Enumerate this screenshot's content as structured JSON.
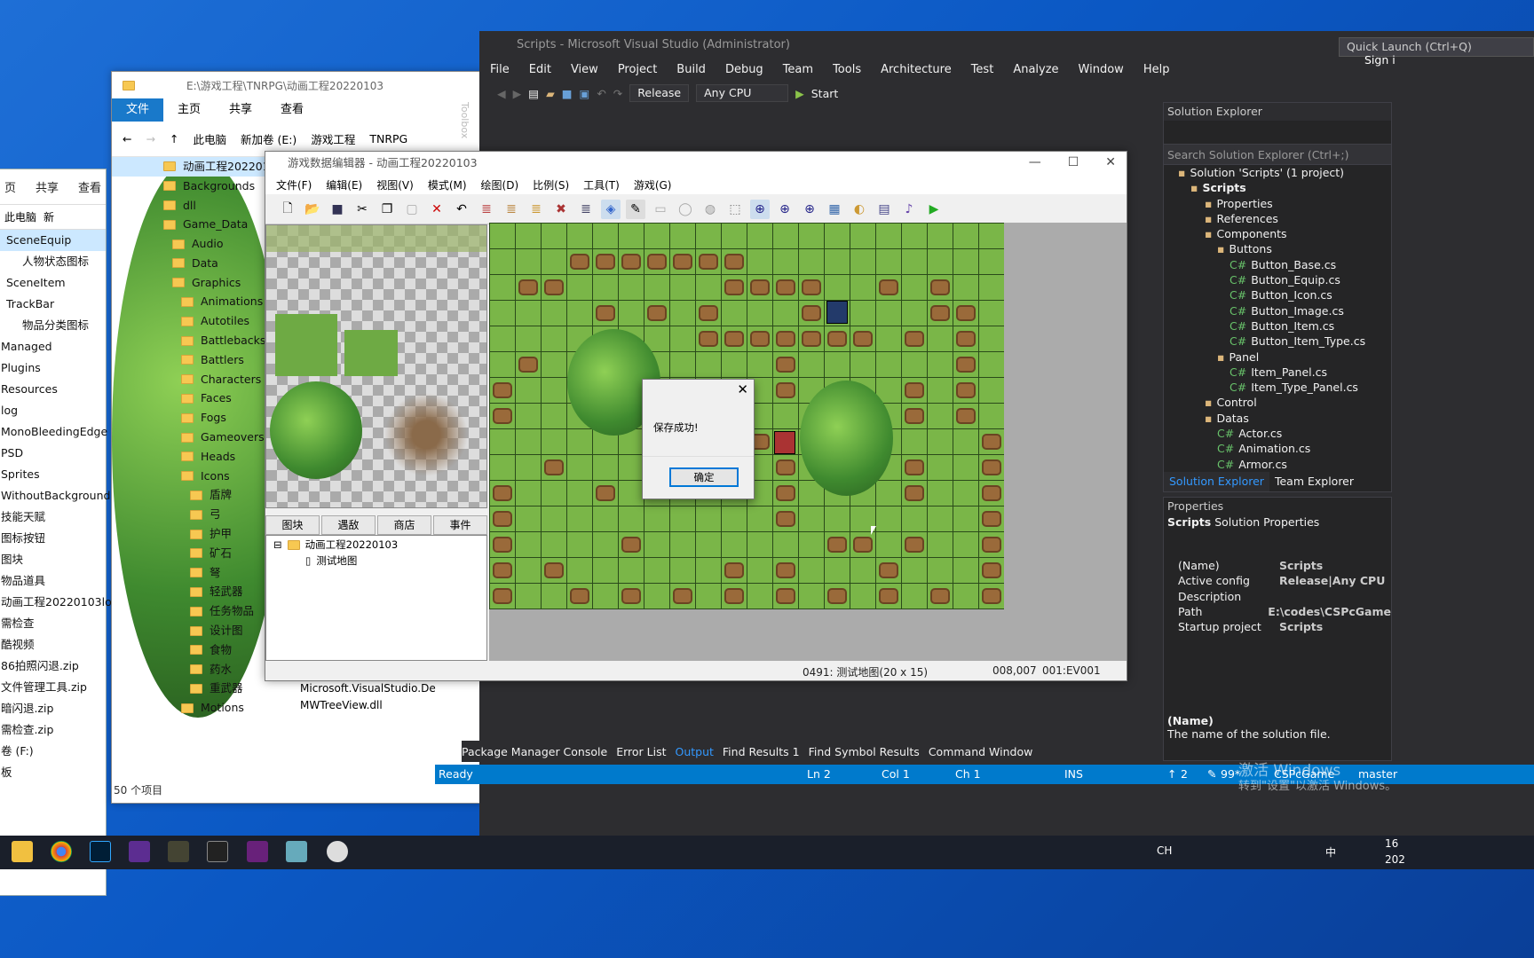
{
  "explorer_back": {
    "ribbon": [
      "页",
      "共享",
      "查看"
    ],
    "address": [
      "此电脑",
      "新"
    ],
    "items": [
      "SceneEquip",
      "人物状态图标",
      "SceneItem",
      "TrackBar",
      "物品分类图标",
      "Managed",
      "Plugins",
      "Resources",
      "log",
      "MonoBleedingEdge",
      "PSD",
      "Sprites",
      "WithoutBackground",
      "技能天赋",
      "图标按钮",
      "图块",
      "物品道具",
      "动画工程20220103log",
      "需检查",
      "酷视频",
      "86拍照闪退.zip",
      "文件管理工具.zip",
      "暗闪退.zip",
      "需检查.zip",
      "卷 (F:)",
      "板"
    ]
  },
  "explorer_front": {
    "path": "E:\\游戏工程\\TNRPG\\动画工程20220103",
    "ribbon": {
      "file": "文件",
      "home": "主页",
      "share": "共享",
      "view": "查看"
    },
    "crumbs": [
      "此电脑",
      "新加卷 (E:)",
      "游戏工程",
      "TNRPG"
    ],
    "tree": [
      "动画工程20220103",
      "Backgrounds",
      "dll",
      "Game_Data",
      "Audio",
      "Data",
      "Graphics",
      "Animations",
      "Autotiles",
      "Battlebacks",
      "Battlers",
      "Characters",
      "Faces",
      "Fogs",
      "Gameovers",
      "Heads",
      "Icons",
      "盾牌",
      "弓",
      "护甲",
      "矿石",
      "弩",
      "轻武器",
      "任务物品",
      "设计图",
      "食物",
      "药水",
      "重武器",
      "Motions"
    ],
    "files": [
      "Microsoft.VisualStudio.De",
      "MWTreeView.dll"
    ],
    "status": "50 个项目"
  },
  "vs": {
    "title": "Scripts - Microsoft Visual Studio (Administrator)",
    "quick_launch": "Quick Launch (Ctrl+Q)",
    "signin": "Sign i",
    "menu": [
      "File",
      "Edit",
      "View",
      "Project",
      "Build",
      "Debug",
      "Team",
      "Tools",
      "Architecture",
      "Test",
      "Analyze",
      "Window",
      "Help"
    ],
    "config": "Release",
    "platform": "Any CPU",
    "start": "Start",
    "toolbox": "Toolbox",
    "solution_explorer": {
      "title": "Solution Explorer",
      "search": "Search Solution Explorer (Ctrl+;)",
      "nodes": [
        "Solution 'Scripts' (1 project)",
        "Scripts",
        "Properties",
        "References",
        "Components",
        "Buttons",
        "Button_Base.cs",
        "Button_Equip.cs",
        "Button_Icon.cs",
        "Button_Image.cs",
        "Button_Item.cs",
        "Button_Item_Type.cs",
        "Panel",
        "Item_Panel.cs",
        "Item_Type_Panel.cs",
        "Control",
        "Datas",
        "Actor.cs",
        "Animation.cs",
        "Armor.cs"
      ],
      "tabs": [
        "Solution Explorer",
        "Team Explorer"
      ]
    },
    "properties": {
      "title": "Properties",
      "subject": "Scripts",
      "subject_type": "Solution Properties",
      "rows": [
        [
          "(Name)",
          "Scripts"
        ],
        [
          "Active config",
          "Release|Any CPU"
        ],
        [
          "Description",
          ""
        ],
        [
          "Path",
          "E:\\codes\\CSPcGame"
        ],
        [
          "Startup project",
          "Scripts"
        ]
      ],
      "desc_title": "(Name)",
      "desc_text": "The name of the solution file."
    },
    "output_tabs": [
      "Package Manager Console",
      "Error List",
      "Output",
      "Find Results 1",
      "Find Symbol Results",
      "Command Window"
    ],
    "status": {
      "ready": "Ready",
      "ln": "Ln 2",
      "col": "Col 1",
      "ch": "Ch 1",
      "ins": "INS",
      "up": "2",
      "pct": "99*",
      "repo": "CSPcGame",
      "branch": "master"
    }
  },
  "editor": {
    "title": "游戏数据编辑器 - 动画工程20220103",
    "menu": [
      "文件(F)",
      "编辑(E)",
      "视图(V)",
      "模式(M)",
      "绘图(D)",
      "比例(S)",
      "工具(T)",
      "游戏(G)"
    ],
    "tabs": [
      "图块",
      "遇敌",
      "商店",
      "事件"
    ],
    "tree_root": "动画工程20220103",
    "tree_child": "测试地图",
    "status_map": "0491: 测试地图(20 x 15)",
    "status_pos": "008,007",
    "status_ev": "001:EV001"
  },
  "dialog": {
    "message": "保存成功!",
    "ok": "确定"
  },
  "watermark": {
    "line1": "激活 Windows",
    "line2": "转到\"设置\"以激活 Windows。"
  },
  "tray": {
    "lang": "CH",
    "ime": "中",
    "time": "16",
    "date": "202"
  }
}
